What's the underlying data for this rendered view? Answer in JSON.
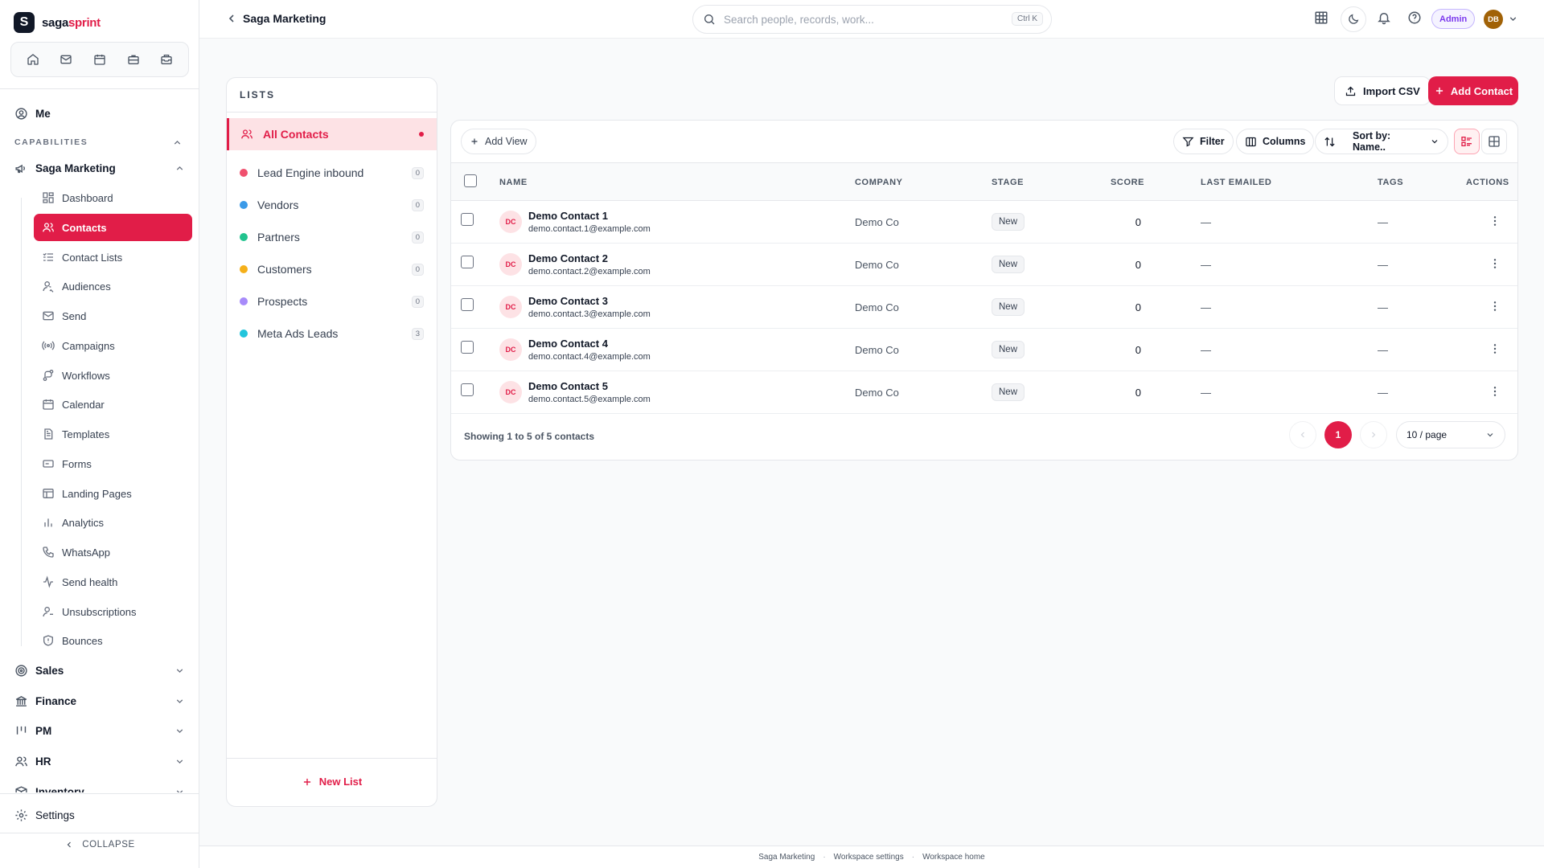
{
  "brand": {
    "name_a": "saga",
    "name_b": "sprint",
    "mark": "S"
  },
  "colors": {
    "accent": "#e11d48",
    "admin": "#7c3aed"
  },
  "sidebar": {
    "quick_icons": [
      "home-icon",
      "mail-icon",
      "calendar-icon",
      "briefcase-icon",
      "inbox-icon"
    ],
    "me_label": "Me",
    "capabilities_label": "CAPABILITIES",
    "group_label": "Saga Marketing",
    "items": [
      {
        "label": "Dashboard",
        "icon": "dashboard-icon"
      },
      {
        "label": "Contacts",
        "icon": "contacts-icon",
        "active": true
      },
      {
        "label": "Contact Lists",
        "icon": "list-icon"
      },
      {
        "label": "Audiences",
        "icon": "audience-icon"
      },
      {
        "label": "Send",
        "icon": "mail-icon"
      },
      {
        "label": "Campaigns",
        "icon": "broadcast-icon"
      },
      {
        "label": "Workflows",
        "icon": "workflow-icon"
      },
      {
        "label": "Calendar",
        "icon": "calendar-icon"
      },
      {
        "label": "Templates",
        "icon": "template-icon"
      },
      {
        "label": "Forms",
        "icon": "form-icon"
      },
      {
        "label": "Landing Pages",
        "icon": "page-icon"
      },
      {
        "label": "Analytics",
        "icon": "analytics-icon"
      },
      {
        "label": "WhatsApp",
        "icon": "phone-icon"
      },
      {
        "label": "Send health",
        "icon": "pulse-icon"
      },
      {
        "label": "Unsubscriptions",
        "icon": "user-minus-icon"
      },
      {
        "label": "Bounces",
        "icon": "shield-icon"
      }
    ],
    "other_groups": [
      {
        "label": "Sales",
        "icon": "target-icon"
      },
      {
        "label": "Finance",
        "icon": "bank-icon"
      },
      {
        "label": "PM",
        "icon": "kanban-icon"
      },
      {
        "label": "HR",
        "icon": "users-icon"
      },
      {
        "label": "Inventory",
        "icon": "box-icon"
      }
    ],
    "settings_label": "Settings",
    "collapse_label": "COLLAPSE"
  },
  "topbar": {
    "workspace_title": "Saga Marketing",
    "search_placeholder": "Search people, records, work...",
    "search_shortcut": "Ctrl K",
    "role_badge": "Admin",
    "avatar_initials": "DB"
  },
  "lists": {
    "header": "LISTS",
    "all_label": "All Contacts",
    "items": [
      {
        "label": "Lead Engine inbound",
        "count": "0",
        "color": "#f0506e"
      },
      {
        "label": "Vendors",
        "count": "0",
        "color": "#3b9ae8"
      },
      {
        "label": "Partners",
        "count": "0",
        "color": "#22c38e"
      },
      {
        "label": "Customers",
        "count": "0",
        "color": "#f5b01a"
      },
      {
        "label": "Prospects",
        "count": "0",
        "color": "#a78bfa"
      },
      {
        "label": "Meta Ads Leads",
        "count": "3",
        "color": "#22c5dc"
      }
    ],
    "new_list_label": "New List"
  },
  "actions": {
    "import_label": "Import CSV",
    "add_label": "Add Contact"
  },
  "toolbar": {
    "add_view": "Add View",
    "filter": "Filter",
    "columns": "Columns",
    "sort": "Sort by: Name.."
  },
  "table": {
    "headers": {
      "name": "NAME",
      "company": "COMPANY",
      "stage": "STAGE",
      "score": "SCORE",
      "last_emailed": "LAST EMAILED",
      "tags": "TAGS",
      "actions": "ACTIONS"
    },
    "rows": [
      {
        "initials": "DC",
        "name": "Demo Contact 1",
        "email": "demo.contact.1@example.com",
        "company": "Demo Co",
        "stage": "New",
        "score": "0",
        "last_emailed": "—",
        "tags": "—"
      },
      {
        "initials": "DC",
        "name": "Demo Contact 2",
        "email": "demo.contact.2@example.com",
        "company": "Demo Co",
        "stage": "New",
        "score": "0",
        "last_emailed": "—",
        "tags": "—"
      },
      {
        "initials": "DC",
        "name": "Demo Contact 3",
        "email": "demo.contact.3@example.com",
        "company": "Demo Co",
        "stage": "New",
        "score": "0",
        "last_emailed": "—",
        "tags": "—"
      },
      {
        "initials": "DC",
        "name": "Demo Contact 4",
        "email": "demo.contact.4@example.com",
        "company": "Demo Co",
        "stage": "New",
        "score": "0",
        "last_emailed": "—",
        "tags": "—"
      },
      {
        "initials": "DC",
        "name": "Demo Contact 5",
        "email": "demo.contact.5@example.com",
        "company": "Demo Co",
        "stage": "New",
        "score": "0",
        "last_emailed": "—",
        "tags": "—"
      }
    ],
    "showing_text": "Showing 1 to 5 of 5 contacts",
    "current_page": "1",
    "per_page": "10 / page"
  },
  "footer": {
    "links": [
      "Saga Marketing",
      "Workspace settings",
      "Workspace home"
    ],
    "separator": "·"
  }
}
